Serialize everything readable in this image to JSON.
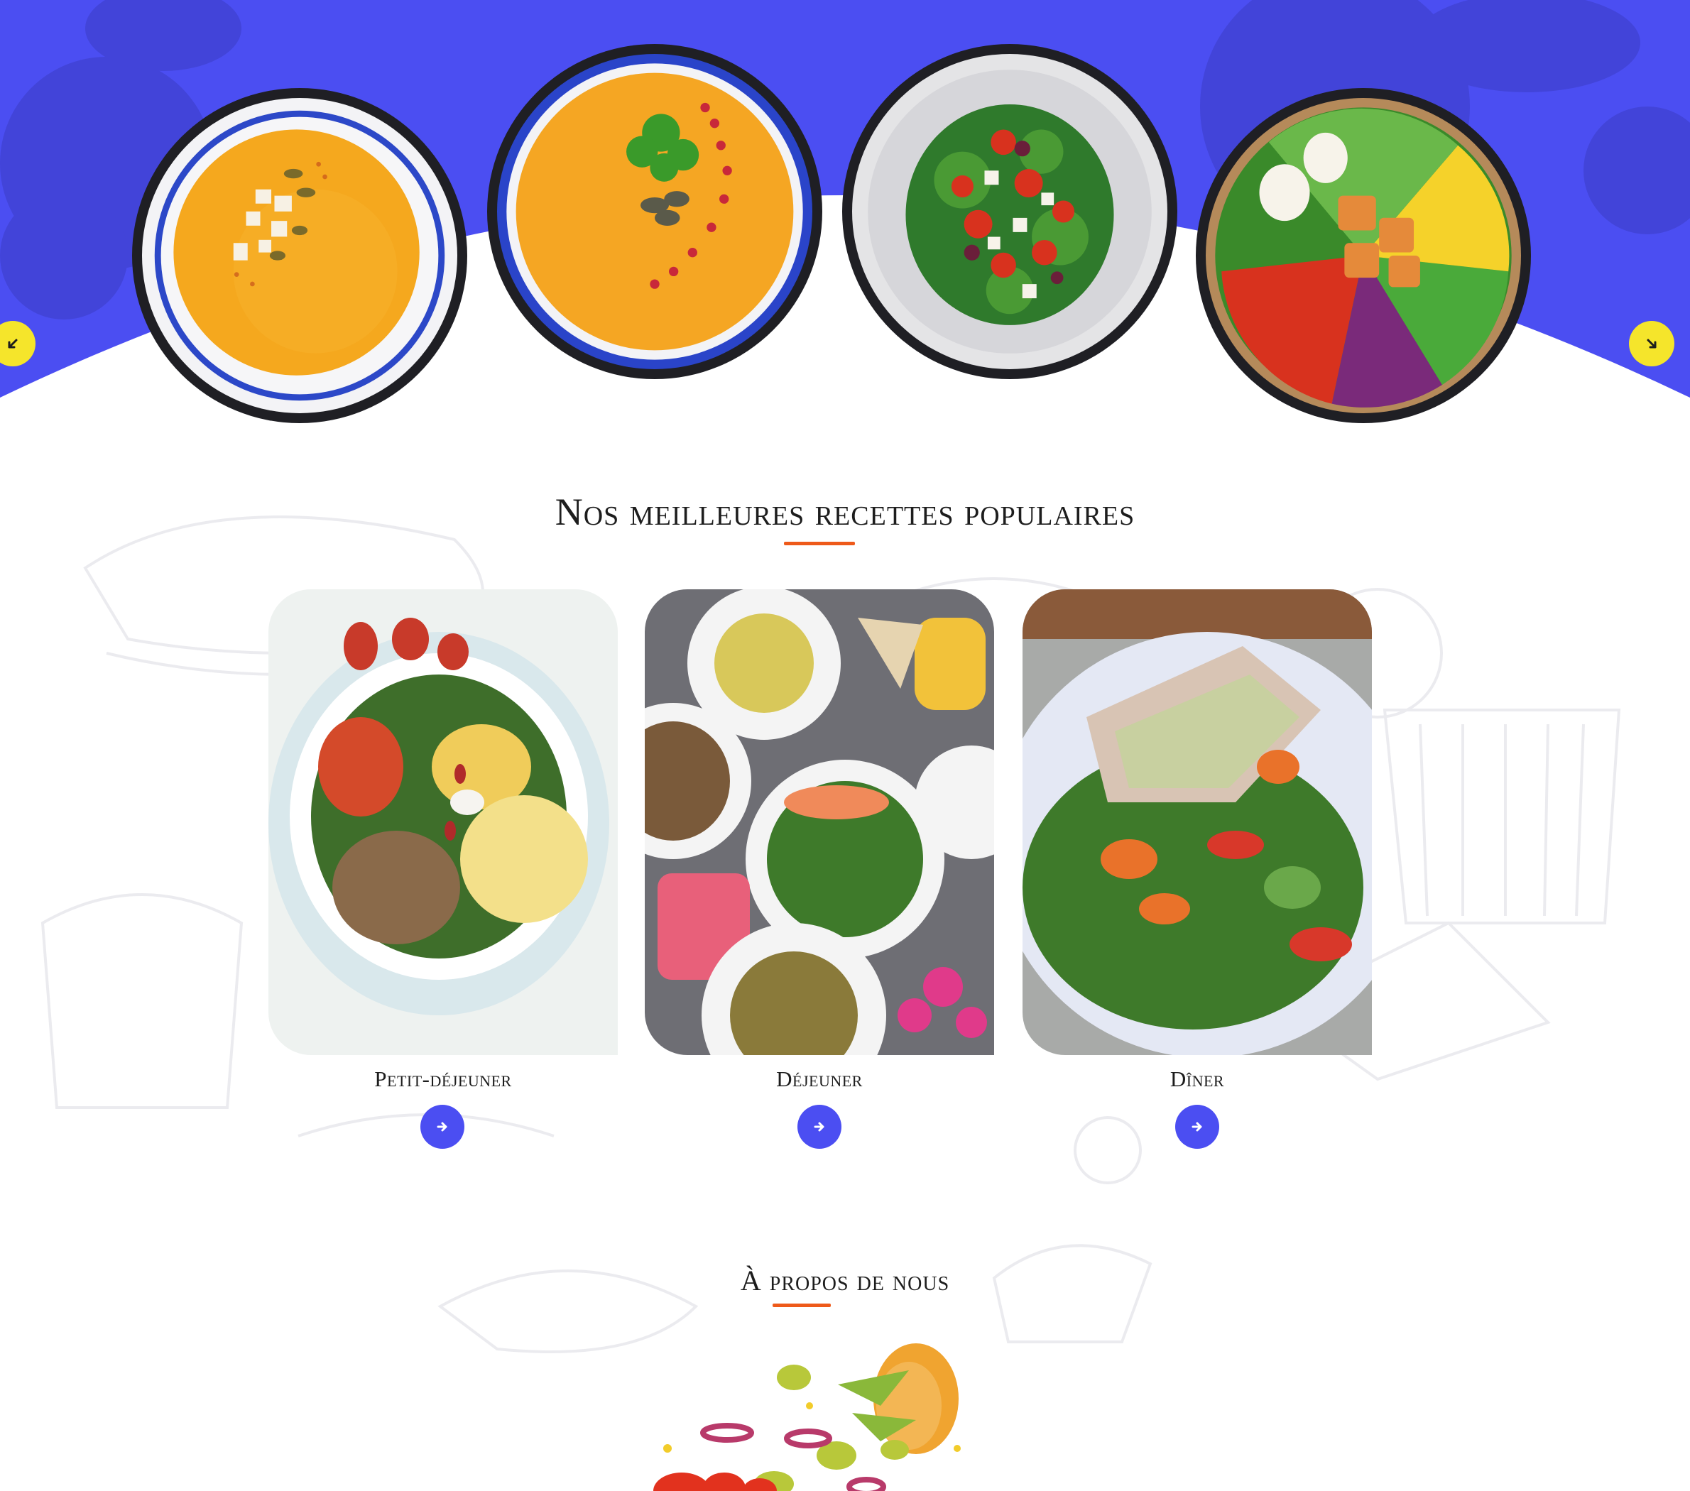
{
  "carousel": {
    "prev_icon": "arrow-left-icon",
    "next_icon": "arrow-right-icon",
    "dishes": [
      {
        "name": "pumpkin-soup-with-feta"
      },
      {
        "name": "pumpkin-soup-with-peppercorns"
      },
      {
        "name": "tomato-feta-salad"
      },
      {
        "name": "salmon-poke-bowl"
      }
    ]
  },
  "popular": {
    "title": "Nos meilleures recettes populaires",
    "cards": [
      {
        "label": "Petit-déjeuner",
        "button_icon": "arrow-right-icon"
      },
      {
        "label": "Déjeuner",
        "button_icon": "arrow-right-icon"
      },
      {
        "label": "Dîner",
        "button_icon": "arrow-right-icon"
      }
    ]
  },
  "about": {
    "title": "À propos de nous"
  },
  "colors": {
    "hero_blue": "#4b4ef2",
    "accent_orange": "#ee5a1a",
    "arrow_yellow": "#f5e52b",
    "card_button": "#4b4ef2",
    "text": "#1d1d1d"
  }
}
